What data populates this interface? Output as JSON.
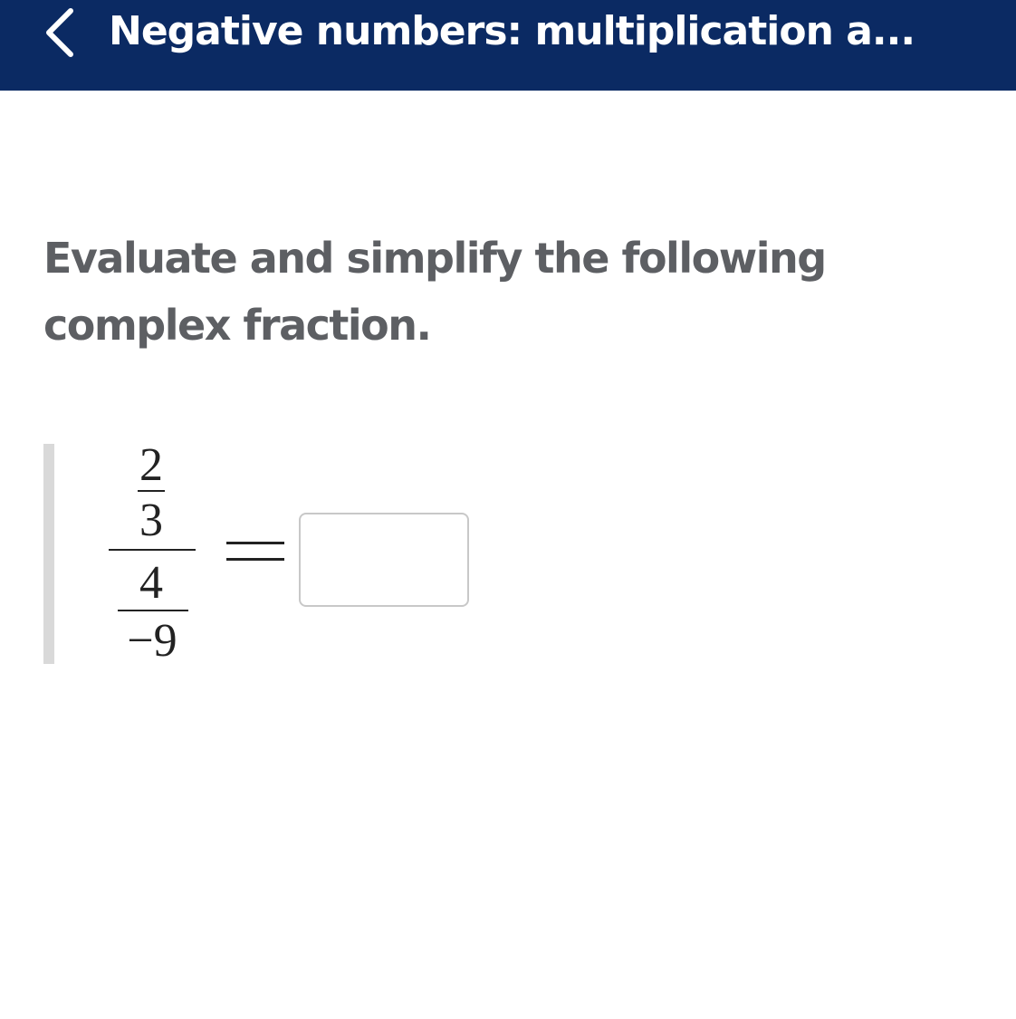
{
  "header": {
    "back_icon": "chevron-left-icon",
    "title": "Negative numbers: multiplication a...",
    "background_color": "#0b2a63"
  },
  "question": {
    "prompt": "Evaluate and simplify the following complex fraction.",
    "expression": {
      "numerator": {
        "top": "2",
        "bottom": "3"
      },
      "denominator": {
        "top": "4",
        "bottom": "−9"
      },
      "equals": "="
    },
    "answer": {
      "value": "",
      "placeholder": ""
    }
  }
}
